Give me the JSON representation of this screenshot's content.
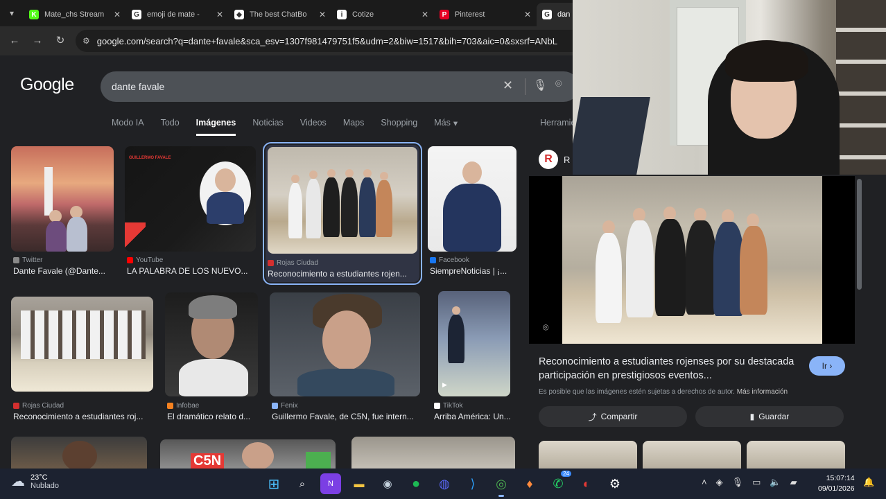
{
  "browser": {
    "tabs": [
      {
        "label": "Mate_chs Stream",
        "fav_color": "#53fc18",
        "fav_text": "K"
      },
      {
        "label": "emoji de mate -",
        "fav_color": "#ffffff",
        "fav_text": "G"
      },
      {
        "label": "The best ChatBo",
        "fav_color": "#ffffff",
        "fav_text": "◆"
      },
      {
        "label": "Cotize",
        "fav_color": "#ffffff",
        "fav_text": "i"
      },
      {
        "label": "Pinterest",
        "fav_color": "#e60023",
        "fav_text": "P"
      },
      {
        "label": "dan",
        "fav_color": "#ffffff",
        "fav_text": "G"
      }
    ],
    "url": "google.com/search?q=dante+favale&sca_esv=1307f981479751f5&udm=2&biw=1517&bih=703&aic=0&sxsrf=ANbL"
  },
  "google": {
    "logo": "Google",
    "query": "dante favale",
    "nav": [
      "Modo IA",
      "Todo",
      "Imágenes",
      "Noticias",
      "Videos",
      "Maps",
      "Shopping",
      "Más"
    ],
    "nav_selected": "Imágenes",
    "more_suffix": "▾",
    "tools": "Herramie"
  },
  "results": [
    {
      "source": "Twitter",
      "title": "Dante Favale (@Dante...",
      "src_color": "#888888"
    },
    {
      "source": "YouTube",
      "title": "LA PALABRA DE LOS NUEVO...",
      "src_color": "#ff0000"
    },
    {
      "source": "Rojas Ciudad",
      "title": "Reconocimiento a estudiantes rojen...",
      "src_color": "#d32f2f"
    },
    {
      "source": "Facebook",
      "title": "SiempreNoticias | ¡...",
      "src_color": "#1877f2"
    },
    {
      "source": "Rojas Ciudad",
      "title": "Reconocimiento a estudiantes roj...",
      "src_color": "#d32f2f"
    },
    {
      "source": "Infobae",
      "title": "El dramático relato d...",
      "src_color": "#f58220"
    },
    {
      "source": "Fenix",
      "title": "Guillermo Favale, de C5N, fue intern...",
      "src_color": "#8ab4f8"
    },
    {
      "source": "TikTok",
      "title": "Arriba América: Un...",
      "src_color": "#ffffff"
    }
  ],
  "thumb_text": {
    "guillermo_name": "GUILLERMO FAVALE",
    "c5n": "C5N"
  },
  "panel": {
    "source_initial": "R",
    "source_name": "R",
    "title": "Reconocimiento a estudiantes rojenses por su destacada participación en prestigiosos eventos...",
    "go": "Ir",
    "copyright": "Es posible que las imágenes estén sujetas a derechos de autor.",
    "more_info": "Más información",
    "share": "Compartir",
    "save": "Guardar"
  },
  "taskbar": {
    "temp": "23°C",
    "weather": "Nublado",
    "time": "15:07:14",
    "date": "09/01/2026",
    "whatsapp_badge": "24"
  }
}
